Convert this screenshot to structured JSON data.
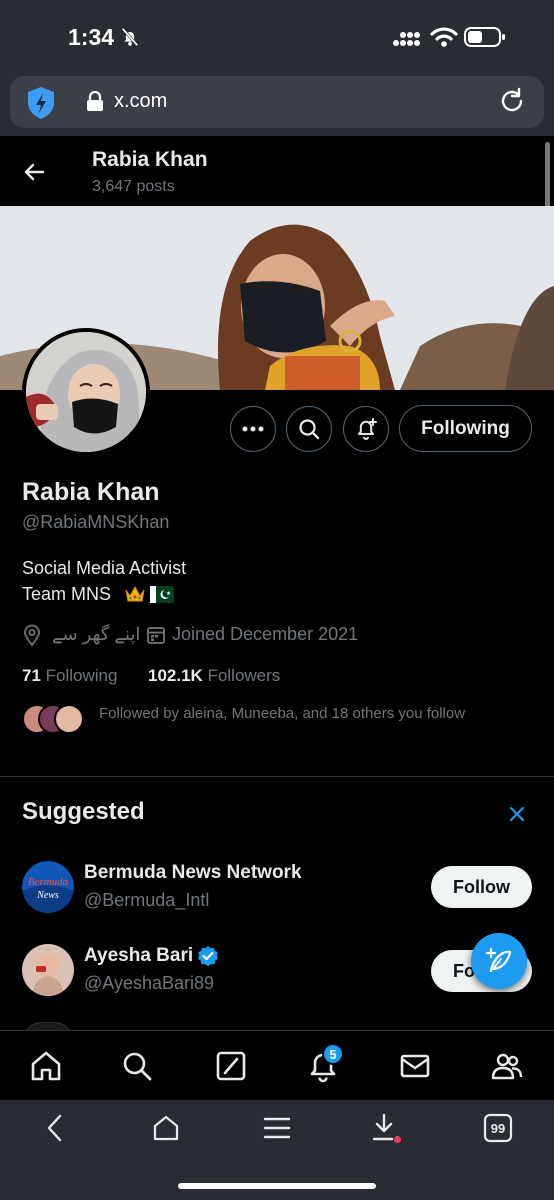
{
  "status_bar": {
    "time": "1:34"
  },
  "browser": {
    "url": "x.com"
  },
  "profile": {
    "topbar_name": "Rabia Khan",
    "posts_count": "3,647 posts",
    "name": "Rabia Khan",
    "handle": "@RabiaMNSKhan",
    "bio_line1": "Social Media Activist",
    "bio_line2": "Team MNS",
    "location": "اپنے گھر سے",
    "joined": "Joined December 2021",
    "following_count": "71",
    "following_label": "Following",
    "followers_count": "102.1K",
    "followers_label": "Followers",
    "followed_by": "Followed by aleina, Muneeba, and 18 others you follow",
    "following_button": "Following"
  },
  "suggested": {
    "title": "Suggested",
    "items": [
      {
        "name": "Bermuda News Network",
        "handle": "@Bermuda_Intl",
        "button": "Follow",
        "avatar_text": "Bermuda News"
      },
      {
        "name": "Ayesha Bari",
        "handle": "@AyeshaBari89",
        "button": "Follow",
        "verified": true
      }
    ]
  },
  "nav": {
    "notification_badge": "5"
  },
  "toolbar": {
    "tabs_count": "99"
  },
  "colors": {
    "accent": "#1d9bf0",
    "background": "#000000",
    "muted_text": "#71767b",
    "browser_chrome": "#2a2c33"
  },
  "icons": [
    "bell-off-icon",
    "signal-icon",
    "wifi-icon",
    "battery-icon",
    "shield-icon",
    "lock-icon",
    "reload-icon",
    "back-arrow-icon",
    "more-icon",
    "search-icon",
    "bell-plus-icon",
    "location-icon",
    "calendar-icon",
    "close-icon",
    "verified-badge-icon",
    "compose-icon",
    "home-icon",
    "grok-icon",
    "notifications-icon",
    "messages-icon",
    "communities-icon",
    "download-icon",
    "menu-icon",
    "tabs-icon"
  ]
}
